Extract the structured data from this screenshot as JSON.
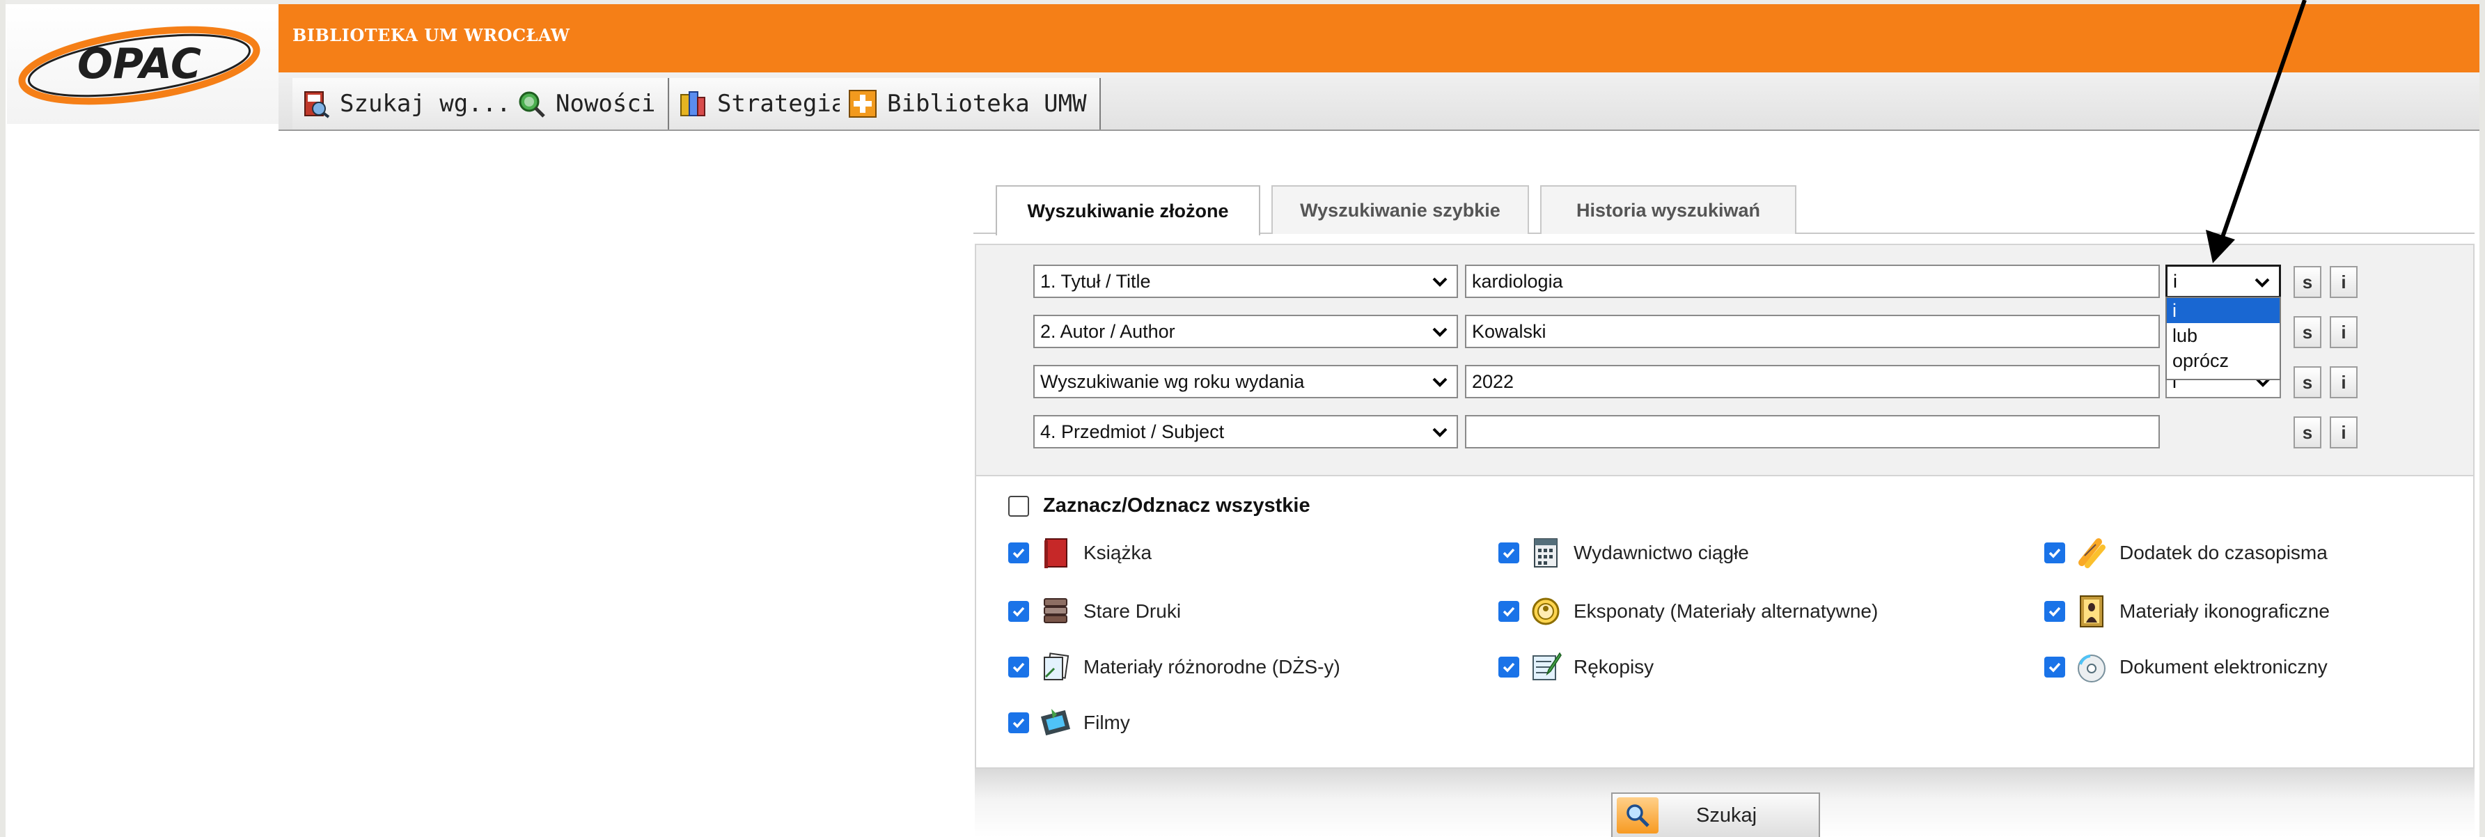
{
  "header": {
    "logo_text": "OPAC",
    "library_name": "BIBLIOTEKA UM WROCŁAW",
    "brand_color": "#f57f17"
  },
  "menu": [
    {
      "label": "Szukaj wg...",
      "icon": "search-book-icon"
    },
    {
      "label": "Nowości",
      "icon": "magnifier-new-icon"
    },
    {
      "label": "Strategia",
      "icon": "strategy-icon"
    },
    {
      "label": "Biblioteka UMW",
      "icon": "plus-icon"
    }
  ],
  "tabs": [
    {
      "label": "Wyszukiwanie złożone",
      "active": true
    },
    {
      "label": "Wyszukiwanie szybkie",
      "active": false
    },
    {
      "label": "Historia wyszukiwań",
      "active": false
    }
  ],
  "search_rows": [
    {
      "field": "1. Tytuł / Title",
      "value": "kardiologia",
      "operator": "i"
    },
    {
      "field": "2. Autor / Author",
      "value": "Kowalski",
      "operator": "i"
    },
    {
      "field": "Wyszukiwanie wg roku wydania",
      "value": "2022",
      "operator": "i"
    },
    {
      "field": "4. Przedmiot / Subject",
      "value": "",
      "operator": ""
    }
  ],
  "row_buttons": {
    "s": "s",
    "i": "i"
  },
  "operator_options": [
    {
      "label": "i",
      "selected": true
    },
    {
      "label": "lub",
      "selected": false
    },
    {
      "label": "oprócz",
      "selected": false
    }
  ],
  "check_all_label": "Zaznacz/Odznacz wszystkie",
  "material_types": [
    {
      "label": "Książka",
      "checked": true,
      "icon": "book-icon"
    },
    {
      "label": "Wydawnictwo ciągłe",
      "checked": true,
      "icon": "periodical-icon"
    },
    {
      "label": "Dodatek do czasopisma",
      "checked": true,
      "icon": "attachment-icon"
    },
    {
      "label": "Stare Druki",
      "checked": true,
      "icon": "old-prints-icon"
    },
    {
      "label": "Eksponaty (Materiały alternatywne)",
      "checked": true,
      "icon": "exhibit-icon"
    },
    {
      "label": "Materiały ikonograficzne",
      "checked": true,
      "icon": "painting-icon"
    },
    {
      "label": "Materiały różnorodne (DŻS-y)",
      "checked": true,
      "icon": "misc-materials-icon"
    },
    {
      "label": "Rękopisy",
      "checked": true,
      "icon": "manuscript-icon"
    },
    {
      "label": "Dokument elektroniczny",
      "checked": true,
      "icon": "cd-icon"
    },
    {
      "label": "Filmy",
      "checked": true,
      "icon": "film-icon"
    }
  ],
  "search_button": {
    "label": "Szukaj",
    "icon": "search-icon"
  },
  "colors": {
    "checkbox": "#1a73e8",
    "dropdown_highlight": "#1967d2"
  }
}
